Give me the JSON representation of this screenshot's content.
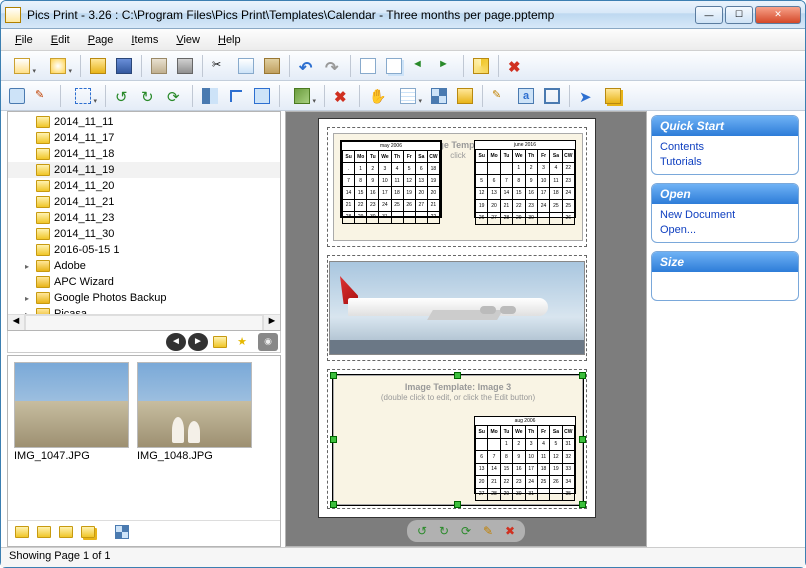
{
  "window": {
    "title": "Pics Print - 3.26 :  C:\\Program Files\\Pics Print\\Templates\\Calendar - Three months per page.pptemp"
  },
  "menu": {
    "file": "File",
    "edit": "Edit",
    "page": "Page",
    "items": "Items",
    "view": "View",
    "help": "Help"
  },
  "folders": {
    "items": [
      {
        "label": "2014_11_11",
        "type": "open"
      },
      {
        "label": "2014_11_17",
        "type": "open"
      },
      {
        "label": "2014_11_18",
        "type": "open"
      },
      {
        "label": "2014_11_19",
        "type": "open",
        "selected": true
      },
      {
        "label": "2014_11_20",
        "type": "open"
      },
      {
        "label": "2014_11_21",
        "type": "open"
      },
      {
        "label": "2014_11_23",
        "type": "open"
      },
      {
        "label": "2014_11_30",
        "type": "open"
      },
      {
        "label": "2016-05-15 1",
        "type": "open"
      },
      {
        "label": "Adobe",
        "type": "closed",
        "expandable": true
      },
      {
        "label": "APC Wizard",
        "type": "closed"
      },
      {
        "label": "Google Photos Backup",
        "type": "closed",
        "expandable": true
      },
      {
        "label": "Picasa",
        "type": "closed",
        "expandable": true
      }
    ]
  },
  "thumbnails": {
    "items": [
      {
        "filename": "IMG_1047.JPG"
      },
      {
        "filename": "IMG_1048.JPG"
      }
    ]
  },
  "canvas": {
    "template_hint_title": "Image Template:",
    "template_hint_line": "click",
    "image3_title": "Image Template: Image 3",
    "image3_sub": "(double click to edit, or click the Edit button)",
    "cal1_title": "may 2006",
    "cal2_title": "june 2016",
    "cal3_title": "aug 2006",
    "days": [
      "Su",
      "Mo",
      "Tu",
      "We",
      "Th",
      "Fr",
      "Sa",
      "CW"
    ]
  },
  "side": {
    "quickstart": {
      "title": "Quick Start",
      "links": [
        "Contents",
        "Tutorials"
      ]
    },
    "open": {
      "title": "Open",
      "links": [
        "New Document",
        "Open..."
      ]
    },
    "size": {
      "title": "Size"
    }
  },
  "status": {
    "text": "Showing Page 1 of 1"
  }
}
